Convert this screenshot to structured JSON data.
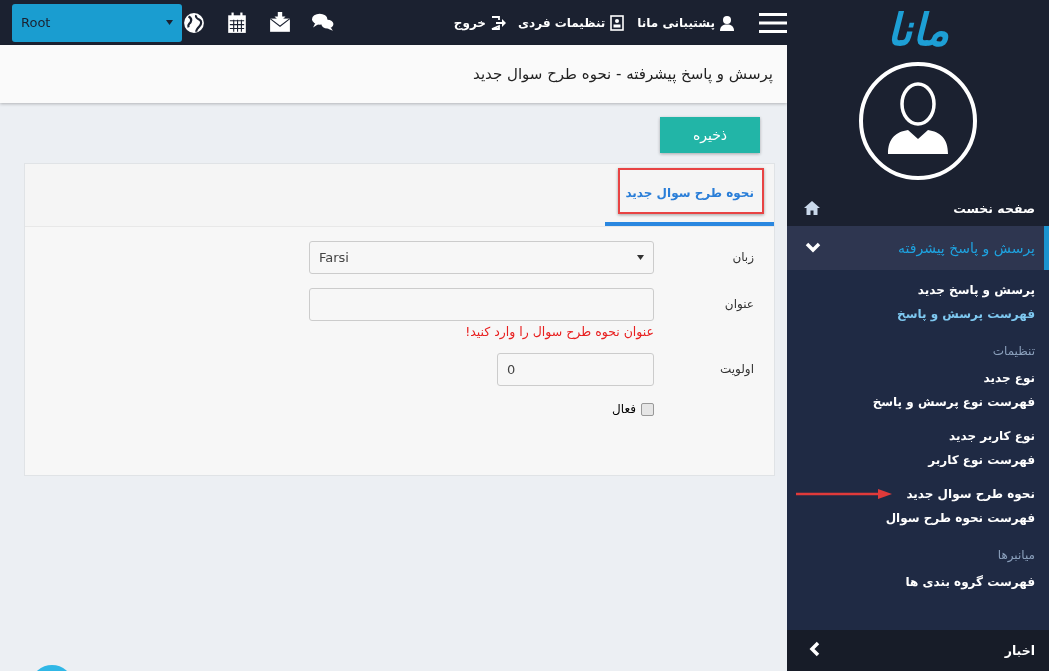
{
  "topbar": {
    "links": [
      {
        "label": "پشتیبانی مانا"
      },
      {
        "label": "تنظیمات فردی"
      },
      {
        "label": "خروج"
      }
    ],
    "root_select": {
      "value": "Root"
    }
  },
  "page_title": "پرسش و پاسخ پیشرفته - نحوه طرح سوال جدید",
  "save_button": "ذخیره",
  "tabs": [
    {
      "label": "نحوه طرح سوال جدید",
      "selected": true,
      "annotated": true
    }
  ],
  "form": {
    "fields": [
      {
        "kind": "select",
        "label": "زبان",
        "value": "Farsi"
      },
      {
        "kind": "text",
        "label": "عنوان",
        "error": "عنوان نحوه طرح سوال را وارد کنید!"
      },
      {
        "kind": "number",
        "label": "اولویت",
        "value": "0"
      },
      {
        "kind": "checkbox",
        "label": "فعال",
        "checked": false
      }
    ]
  },
  "sidebar": {
    "logo": "مانا",
    "home": "صفحه نخست",
    "section": {
      "label": "پرسش و پاسخ پیشرفته",
      "expanded": true
    },
    "items": [
      {
        "kind": "link",
        "label": "پرسش و پاسخ جدید",
        "highlighted": false,
        "arrow": false
      },
      {
        "kind": "link",
        "label": "فهرست پرسش و پاسخ",
        "highlighted": true,
        "arrow": false
      },
      {
        "kind": "heading",
        "label": "تنظیمات"
      },
      {
        "kind": "link",
        "label": "نوع جدید",
        "highlighted": false,
        "arrow": false
      },
      {
        "kind": "link",
        "label": "فهرست نوع پرسش و پاسخ",
        "highlighted": false,
        "arrow": false
      },
      {
        "kind": "gap"
      },
      {
        "kind": "link",
        "label": "نوع کاربر جدید",
        "highlighted": false,
        "arrow": false
      },
      {
        "kind": "link",
        "label": "فهرست نوع کاربر",
        "highlighted": false,
        "arrow": false
      },
      {
        "kind": "gap"
      },
      {
        "kind": "link",
        "label": "نحوه طرح سوال جدید",
        "highlighted": false,
        "arrow": true
      },
      {
        "kind": "link",
        "label": "فهرست نحوه طرح سوال",
        "highlighted": false,
        "arrow": false
      },
      {
        "kind": "heading",
        "label": "میانبرها"
      },
      {
        "kind": "link",
        "label": "فهرست گروه بندی ها",
        "highlighted": false,
        "arrow": false
      }
    ],
    "footer": {
      "label": "اخبار",
      "expanded": false
    }
  }
}
